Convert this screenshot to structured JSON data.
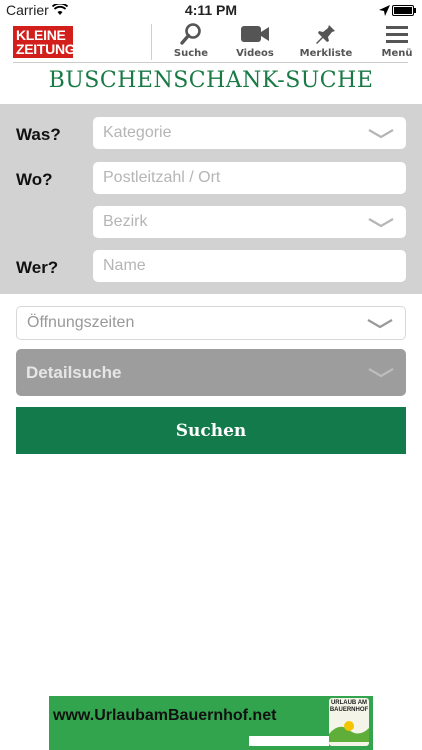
{
  "status_bar": {
    "carrier": "Carrier",
    "time": "4:11 PM"
  },
  "logo": {
    "line1": "KLEINE",
    "line2": "ZEITUNG"
  },
  "nav": {
    "items": [
      {
        "label": "Suche",
        "icon": "search-icon"
      },
      {
        "label": "Videos",
        "icon": "video-camera-icon"
      },
      {
        "label": "Merkliste",
        "icon": "pin-icon"
      },
      {
        "label": "Menü",
        "icon": "hamburger-menu-icon"
      }
    ]
  },
  "page_title": "BUSCHENSCHANK-SUCHE",
  "form": {
    "was_label": "Was?",
    "kategorie_placeholder": "Kategorie",
    "wo_label": "Wo?",
    "plz_placeholder": "Postleitzahl / Ort",
    "bezirk_placeholder": "Bezirk",
    "wer_label": "Wer?",
    "name_placeholder": "Name",
    "oeffnungszeiten_placeholder": "Öffnungszeiten",
    "detailsuche_label": "Detailsuche",
    "search_button": "Suchen"
  },
  "colors": {
    "brand_green": "#137a4b",
    "title_green": "#1a7a45",
    "logo_red": "#d21f1b",
    "form_gray": "#d2d2d2"
  },
  "ad": {
    "url": "www.UrlaubamBauernhof.net",
    "badge": "URLAUB AM BAUERNHOF"
  }
}
